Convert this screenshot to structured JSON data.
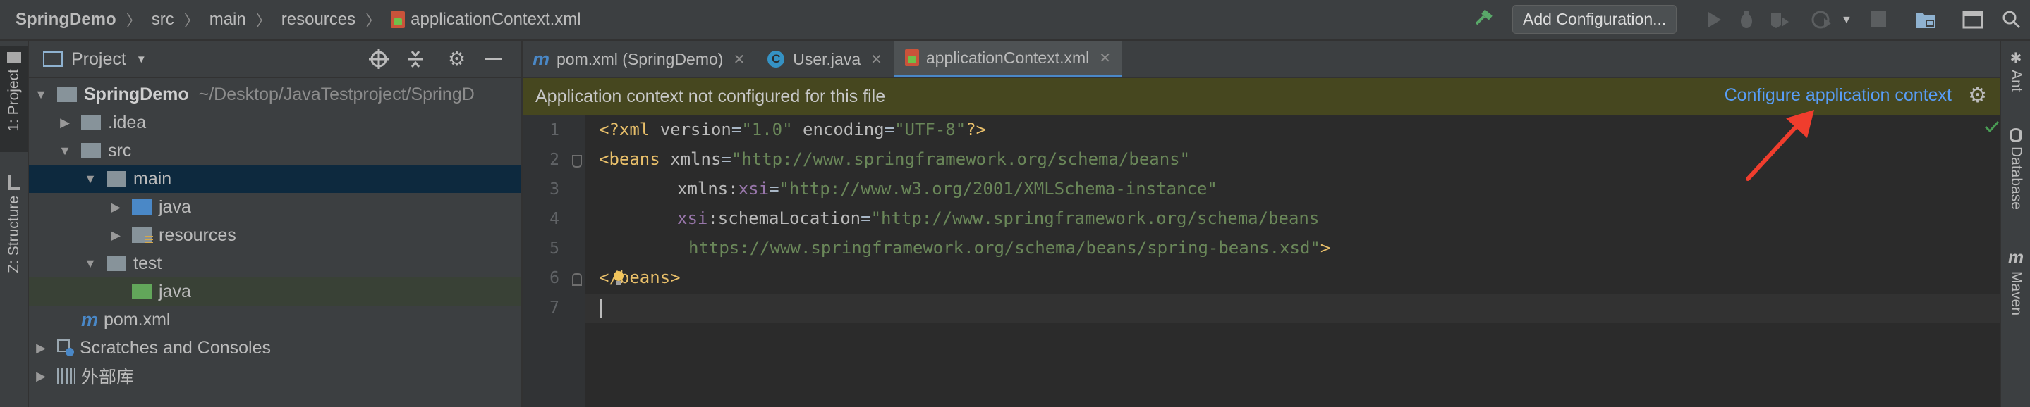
{
  "breadcrumbs": [
    "SpringDemo",
    "src",
    "main",
    "resources",
    "applicationContext.xml"
  ],
  "toolbar": {
    "add_config_label": "Add Configuration..."
  },
  "left_stripe": {
    "project_tab": "1: Project",
    "structure_tab": "Z: Structure"
  },
  "right_stripe": {
    "ant_tab": "Ant",
    "database_tab": "Database",
    "maven_tab": "Maven"
  },
  "project_panel": {
    "title": "Project",
    "tree": [
      {
        "label": "SpringDemo",
        "suffix": "~/Desktop/JavaTestproject/SpringD"
      },
      {
        "label": ".idea"
      },
      {
        "label": "src"
      },
      {
        "label": "main"
      },
      {
        "label": "java"
      },
      {
        "label": "resources"
      },
      {
        "label": "test"
      },
      {
        "label": "java"
      },
      {
        "label": "pom.xml"
      },
      {
        "label": "Scratches and Consoles"
      },
      {
        "label": "外部库"
      }
    ]
  },
  "editor_tabs": [
    {
      "label": "pom.xml (SpringDemo)"
    },
    {
      "label": "User.java"
    },
    {
      "label": "applicationContext.xml"
    }
  ],
  "banner": {
    "message": "Application context not configured for this file",
    "link": "Configure application context"
  },
  "code": {
    "line_numbers": [
      "1",
      "2",
      "3",
      "4",
      "5",
      "6",
      "7"
    ],
    "l1": {
      "a": "<?xml ",
      "b": "version",
      "c": "=",
      "d": "\"1.0\"",
      "e": " encoding",
      "f": "=",
      "g": "\"UTF-8\"",
      "h": "?>"
    },
    "l2": {
      "a": "<beans ",
      "b": "xmlns",
      "c": "=",
      "d": "\"http://www.springframework.org/schema/beans\""
    },
    "l3": {
      "a": "xmlns",
      "b": ":",
      "c": "xsi",
      "d": "=",
      "e": "\"http://www.w3.org/2001/XMLSchema-instance\""
    },
    "l4": {
      "a": "xsi",
      "b": ":schemaLocation",
      "c": "=",
      "d": "\"http://www.springframework.org/schema/beans"
    },
    "l5": {
      "a": "https://www.springframework.org/schema/beans/spring-beans.xsd\"",
      "b": ">"
    },
    "l6": {
      "a": "<",
      "b": "/beans>"
    }
  },
  "colors": {
    "accent": "#4a88c7",
    "banner_bg": "#46471f",
    "link": "#589df6",
    "annotation_arrow": "#f03d2d"
  }
}
